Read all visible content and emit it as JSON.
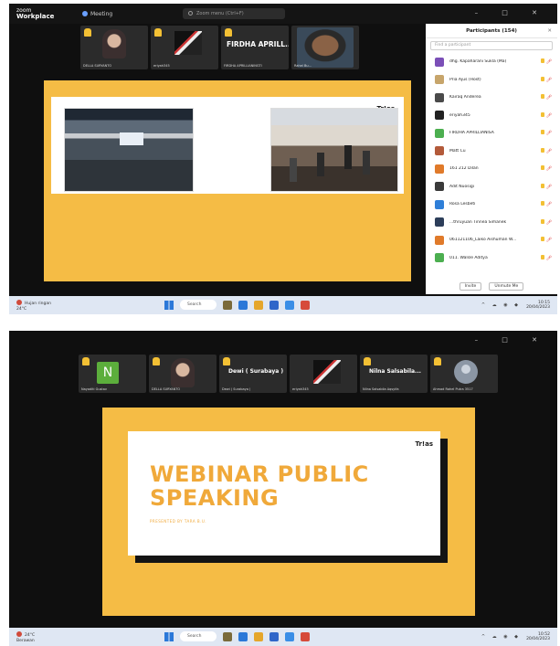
{
  "colors": {
    "accent": "#f5bc45",
    "slide_title": "#f0a93a",
    "hand_raised": "#f3c034"
  },
  "shot1": {
    "app": {
      "brand_top": "zoom",
      "brand_name": "Workplace"
    },
    "meeting_label": "Meeting",
    "search_placeholder": "Zoom menu (Ctrl+F)",
    "window_controls": "– □ ✕",
    "tiles": [
      {
        "name": "DELLA SURYANTO",
        "kind": "hijab"
      },
      {
        "name": "eriyah345",
        "kind": "guitar"
      },
      {
        "big_name": "FIRDHA APRILL...",
        "name": "FIRDHA APRILLIANINGTI",
        "kind": "text"
      },
      {
        "name": "Rahel Bu...",
        "kind": "man"
      }
    ],
    "slide": {
      "logo": "Tr!as"
    },
    "panel": {
      "title": "Participants (154)",
      "search_placeholder": "Find a participant",
      "participants": [
        {
          "name": "dhg. Kapaharani Sukla (Ma)",
          "color": "#7b4fb7"
        },
        {
          "name": "Pria Ajus (Host)",
          "color": "#c7a56b"
        },
        {
          "name": "Kairaq Anderea",
          "color": "#4a4a4a"
        },
        {
          "name": "eriyah345",
          "color": "#222222"
        },
        {
          "name": "FIRDHA APRILLIANISA",
          "color": "#4caf50"
        },
        {
          "name": "Matt Cu",
          "color": "#b35a3a"
        },
        {
          "name": "161 212 Dilan",
          "color": "#e07a2a"
        },
        {
          "name": "Adit Nuosigi",
          "color": "#3a3a3a"
        },
        {
          "name": "Rosa Lesbeti",
          "color": "#2f7fd8"
        },
        {
          "name": "...thruyuan Tinnea Simanek",
          "color": "#2d3e5a"
        },
        {
          "name": "061121106_Laiko Aishuman W...",
          "color": "#e07a2a"
        },
        {
          "name": "011. Walsle Aditya",
          "color": "#4caf50"
        }
      ],
      "invite_label": "Invite",
      "unmute_label": "Unmute Me"
    },
    "taskbar": {
      "weather_line1": "Hujan ringan",
      "weather_line2": "24°C",
      "search_label": "Search",
      "time": "10:15",
      "date": "20/04/2023"
    }
  },
  "shot2": {
    "window_controls": "– □ ✕",
    "tiles": [
      {
        "name": "Nayaditi Gustav",
        "kind": "avatar-n",
        "initial": "N"
      },
      {
        "name": "DELLA SURYANTO",
        "kind": "hijab"
      },
      {
        "big_name": "Dewi ( Surabaya )",
        "name": "Dewi ( Surabaya )",
        "kind": "text"
      },
      {
        "name": "eriyah345",
        "kind": "guitar"
      },
      {
        "big_name": "Nilna Salsabila...",
        "name": "Nilna Salsabila Aqsyifa",
        "kind": "text"
      },
      {
        "name": "Ahmad Rahel Putra 3517",
        "kind": "avatar"
      }
    ],
    "slide": {
      "logo": "Tr!as",
      "title_line1": "WEBINAR PUBLIC",
      "title_line2": "SPEAKING",
      "subtitle": "PRESENTED BY TARA B.U."
    },
    "taskbar": {
      "weather_line1": "24°C",
      "weather_line2": "Berawan",
      "search_label": "Search",
      "time": "10:52",
      "date": "20/04/2023"
    }
  }
}
